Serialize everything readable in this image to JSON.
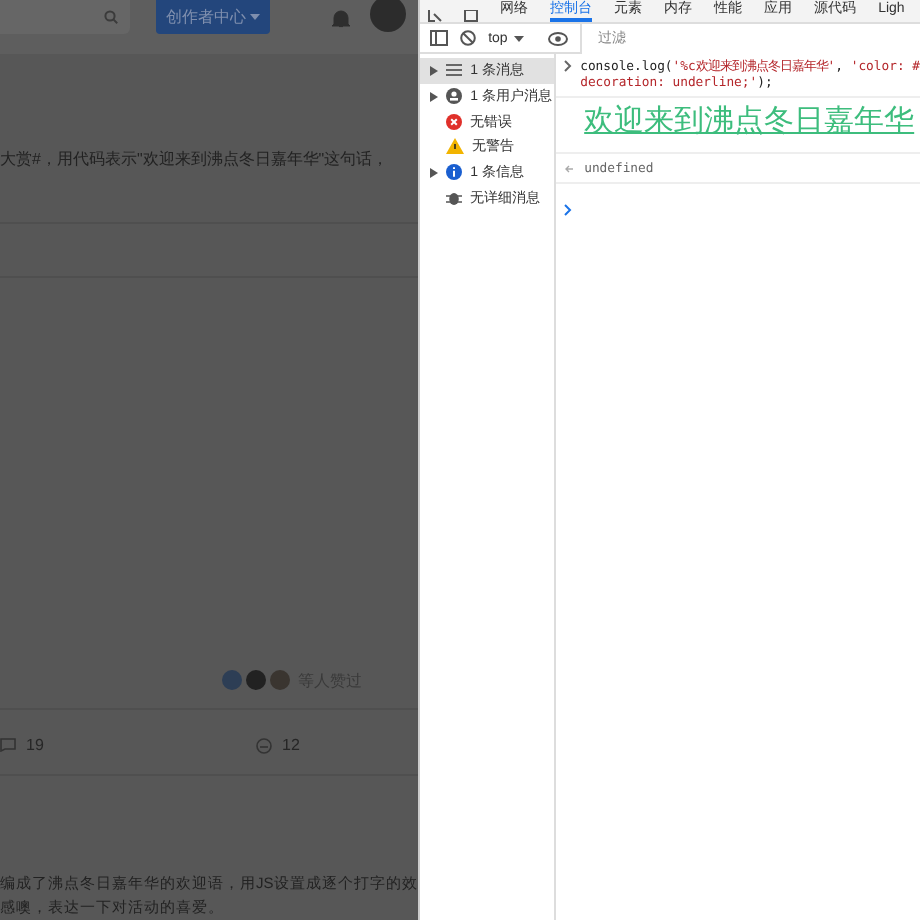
{
  "page": {
    "creator_button": "创作者中心",
    "post_text": "大赏#，用代码表示\"欢迎来到沸点冬日嘉年华\"这句话，",
    "likes_label": "等人赞过",
    "stats": [
      {
        "kind": "comment",
        "count": "19"
      },
      {
        "kind": "like",
        "count": "12"
      }
    ],
    "comment_lines": [
      "编成了沸点冬日嘉年华的欢迎语，用JS设置成逐个打字的效",
      "感噢，表达一下对活动的喜爱。"
    ]
  },
  "devtools": {
    "tabs": [
      {
        "label": "网络",
        "selected": false
      },
      {
        "label": "控制台",
        "selected": true
      },
      {
        "label": "元素",
        "selected": false
      },
      {
        "label": "内存",
        "selected": false
      },
      {
        "label": "性能",
        "selected": false
      },
      {
        "label": "应用",
        "selected": false
      },
      {
        "label": "源代码",
        "selected": false
      },
      {
        "label": "Ligh",
        "selected": false
      }
    ],
    "context": "top",
    "filter_placeholder": "过滤",
    "sidebar": [
      {
        "kind": "list",
        "label": "1 条消息",
        "expandable": true,
        "selected": true
      },
      {
        "kind": "user",
        "label": "1 条用户消息",
        "expandable": true,
        "selected": false
      },
      {
        "kind": "error",
        "label": "无错误",
        "expandable": false,
        "selected": false
      },
      {
        "kind": "warning",
        "label": "无警告",
        "expandable": false,
        "selected": false
      },
      {
        "kind": "info",
        "label": "1 条信息",
        "expandable": true,
        "selected": false
      },
      {
        "kind": "verbose",
        "label": "无详细消息",
        "expandable": false,
        "selected": false
      }
    ],
    "command": [
      [
        {
          "kind": "code",
          "text": "console.log("
        },
        {
          "kind": "string",
          "text": "'%c欢迎来到沸点冬日嘉年华'"
        },
        {
          "kind": "code",
          "text": ", "
        },
        {
          "kind": "string",
          "text": "'color: #"
        }
      ],
      [
        {
          "kind": "string",
          "text": "decoration: underline;'"
        },
        {
          "kind": "code",
          "text": ");"
        }
      ]
    ],
    "output": {
      "text": "欢迎来到沸点冬日嘉年华",
      "color": "#3dbd7d"
    },
    "result": "undefined"
  }
}
